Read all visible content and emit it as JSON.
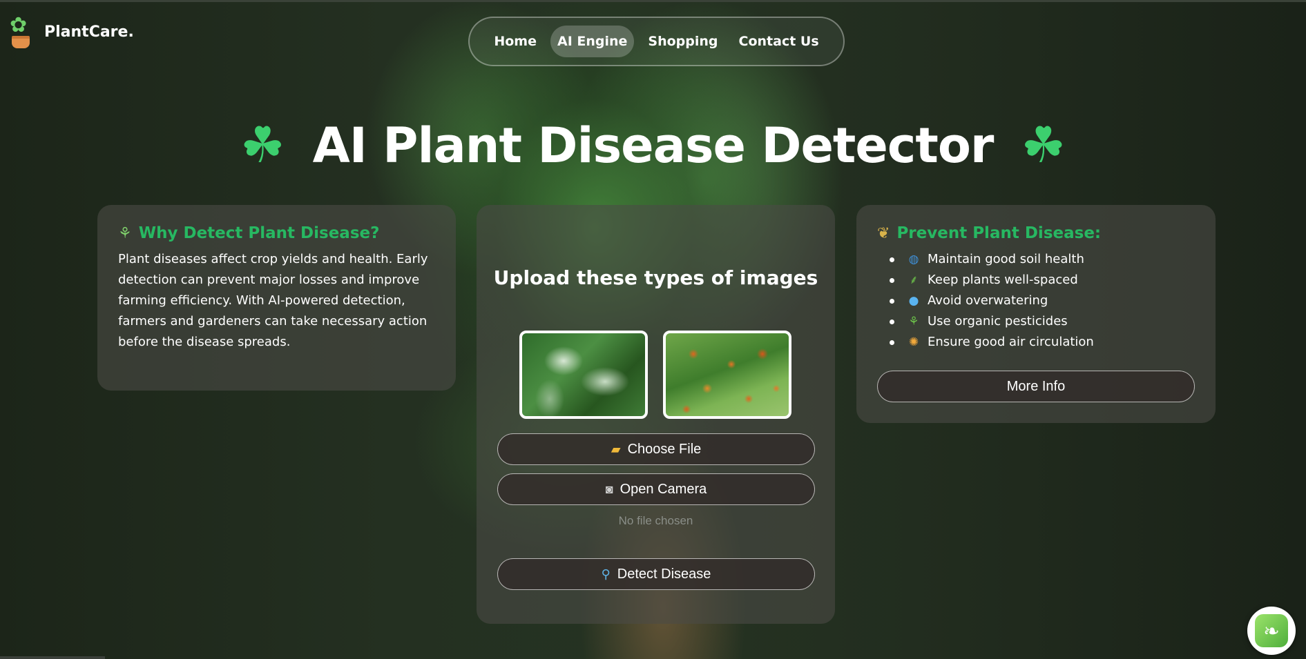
{
  "brand": {
    "name": "PlantCare.",
    "logo_icon": "potted-plant-icon"
  },
  "nav": {
    "items": [
      {
        "label": "Home",
        "active": false
      },
      {
        "label": "AI Engine",
        "active": true
      },
      {
        "label": "Shopping",
        "active": false
      },
      {
        "label": "Contact Us",
        "active": false
      }
    ]
  },
  "hero": {
    "title": "AI Plant Disease Detector",
    "icon": "four-leaf-clover-icon"
  },
  "why_card": {
    "icon": "seedling-icon",
    "heading": "Why Detect Plant Disease?",
    "body": "Plant diseases affect crop yields and health. Early detection can prevent major losses and improve farming efficiency. With AI-powered detection, farmers and gardeners can take necessary action before the disease spreads."
  },
  "upload_card": {
    "title": "Upload these types of images",
    "samples": [
      {
        "name": "powdery-mildew-leaf-image"
      },
      {
        "name": "rust-spots-leaf-image"
      }
    ],
    "choose_file_label": "Choose File",
    "open_camera_label": "Open Camera",
    "file_status": "No file chosen",
    "detect_label": "Detect Disease"
  },
  "prevent_card": {
    "icon": "wheat-icon",
    "heading": "Prevent Plant Disease:",
    "items": [
      {
        "icon": "globe-icon",
        "text": "Maintain good soil health"
      },
      {
        "icon": "herb-icon",
        "text": "Keep plants well-spaced"
      },
      {
        "icon": "droplet-icon",
        "text": "Avoid overwatering"
      },
      {
        "icon": "seedling-icon",
        "text": "Use organic pesticides"
      },
      {
        "icon": "sun-icon",
        "text": "Ensure good air circulation"
      }
    ],
    "more_info_label": "More Info"
  },
  "fab": {
    "icon": "leaf-icon"
  },
  "colors": {
    "accent_green": "#27b862",
    "card_bg": "rgba(75,75,70,0.6)"
  }
}
